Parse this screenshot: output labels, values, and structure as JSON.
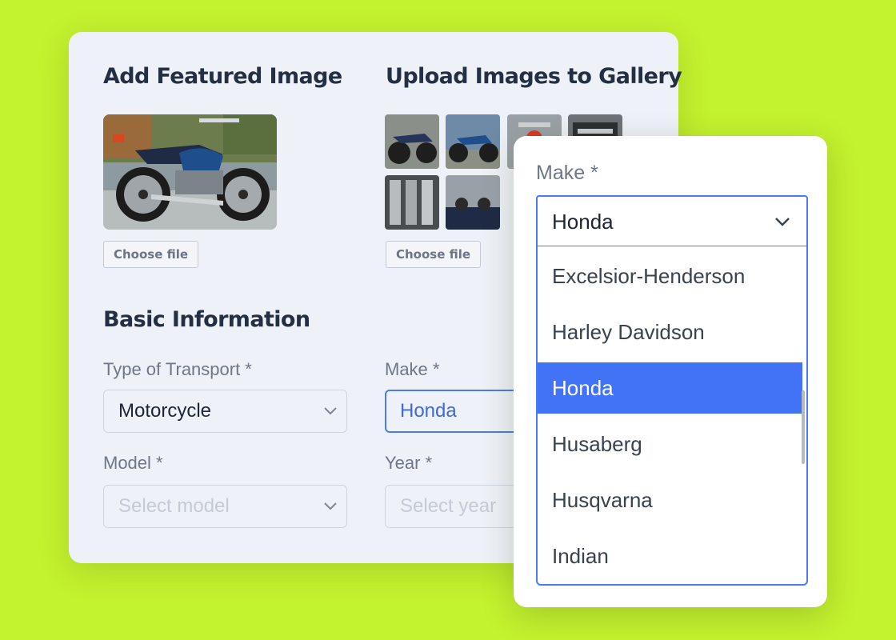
{
  "colors": {
    "background": "#c3f22e",
    "accent": "#4272f5",
    "card": "#eef1f7"
  },
  "featured": {
    "heading": "Add Featured Image",
    "choose_file_label": "Choose file"
  },
  "gallery": {
    "heading": "Upload Images to Gallery",
    "choose_file_label": "Choose file"
  },
  "basic_info": {
    "heading": "Basic Information",
    "transport_label": "Type of Transport *",
    "transport_value": "Motorcycle",
    "make_label": "Make *",
    "make_value": "Honda",
    "model_label": "Model *",
    "model_placeholder": "Select model",
    "year_label": "Year *",
    "year_placeholder": "Select year"
  },
  "dropdown": {
    "label": "Make *",
    "selected_value": "Honda",
    "options": [
      {
        "label": "Excelsior-Henderson"
      },
      {
        "label": "Harley Davidson"
      },
      {
        "label": "Honda",
        "selected": true
      },
      {
        "label": "Husaberg"
      },
      {
        "label": "Husqvarna"
      },
      {
        "label": "Indian"
      }
    ]
  },
  "icons": {
    "chevron": "chevron-down-icon"
  }
}
